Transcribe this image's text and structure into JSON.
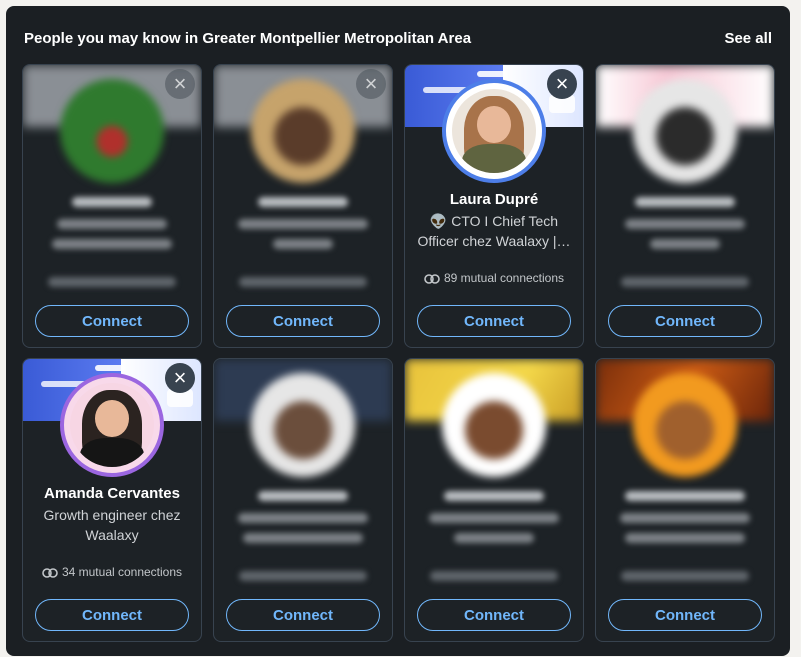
{
  "section": {
    "title": "People you may know in Greater Montpellier Metropolitan Area",
    "see_all": "See all"
  },
  "cards": [
    {
      "name": "",
      "headline": "",
      "mutual": "",
      "connect": "Connect",
      "blurred": true
    },
    {
      "name": "",
      "headline": "",
      "mutual": "",
      "connect": "Connect",
      "blurred": true
    },
    {
      "name": "Laura Dupré",
      "headline_line1": "👽 CTO I Chief Tech",
      "headline_line2": "Officer chez Waalaxy |…",
      "mutual": "89 mutual connections",
      "connect": "Connect",
      "blurred": false
    },
    {
      "name": "",
      "headline": "",
      "mutual": "",
      "connect": "Connect",
      "blurred": true
    },
    {
      "name": "Amanda Cervantes",
      "headline_line1": "Growth engineer chez",
      "headline_line2": "Waalaxy",
      "mutual": "34 mutual connections",
      "connect": "Connect",
      "blurred": false
    },
    {
      "name": "",
      "headline": "",
      "mutual": "",
      "connect": "Connect",
      "blurred": true
    },
    {
      "name": "",
      "headline": "",
      "mutual": "",
      "connect": "Connect",
      "blurred": true
    },
    {
      "name": "",
      "headline": "",
      "mutual": "",
      "connect": "Connect",
      "blurred": true
    }
  ],
  "icons": {
    "dismiss": "close-icon",
    "mutual": "mutual-connections-icon"
  },
  "colors": {
    "panel_bg": "#1b1f23",
    "link": "#71b7fb",
    "text": "#ffffff"
  }
}
